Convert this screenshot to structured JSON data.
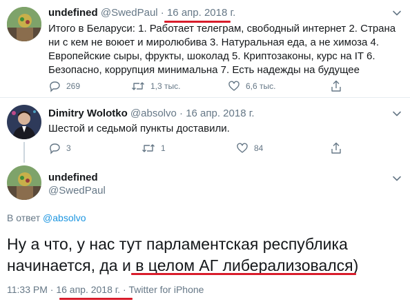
{
  "tweet1": {
    "name": "undefined",
    "handle": "@SwedPaul",
    "separator": "·",
    "date": "16 апр. 2018 г.",
    "text_lines": [
      "Итого в Беларуси: 1. Работает телеграм, свободный интернет 2. Страна",
      "ни с кем не воюет и миролюбива 3. Натуральная еда, а не химоза 4.",
      "Европейские сыры, фрукты, шоколад 5. Криптозаконы, курс на IT 6.",
      "Безопасно, коррупция минимальна 7. Есть надежды на будущее"
    ],
    "replies": "269",
    "retweets": "1,3 тыс.",
    "likes": "6,6 тыс."
  },
  "tweet2": {
    "name": "Dimitry Wolotko",
    "handle": "@absolvo",
    "separator": "·",
    "date": "16 апр. 2018 г.",
    "text": "Шестой и седьмой пункты доставили.",
    "replies": "3",
    "retweets": "1",
    "likes": "84"
  },
  "tweet3": {
    "name": "undefined",
    "handle": "@SwedPaul",
    "reply_prefix": "В ответ",
    "reply_to": "@absolvo",
    "text_lines": [
      "Ну а что, у нас тут парламентская республика",
      "начинается, да и в целом АГ либерализовался)"
    ],
    "time": "11:33 PM",
    "separator": "·",
    "date": "16 апр. 2018 г.",
    "source": "Twitter for iPhone"
  },
  "colors": {
    "text": "#14171a",
    "secondary": "#657786",
    "link": "#1b95e0",
    "annotation": "#d91c2b"
  }
}
